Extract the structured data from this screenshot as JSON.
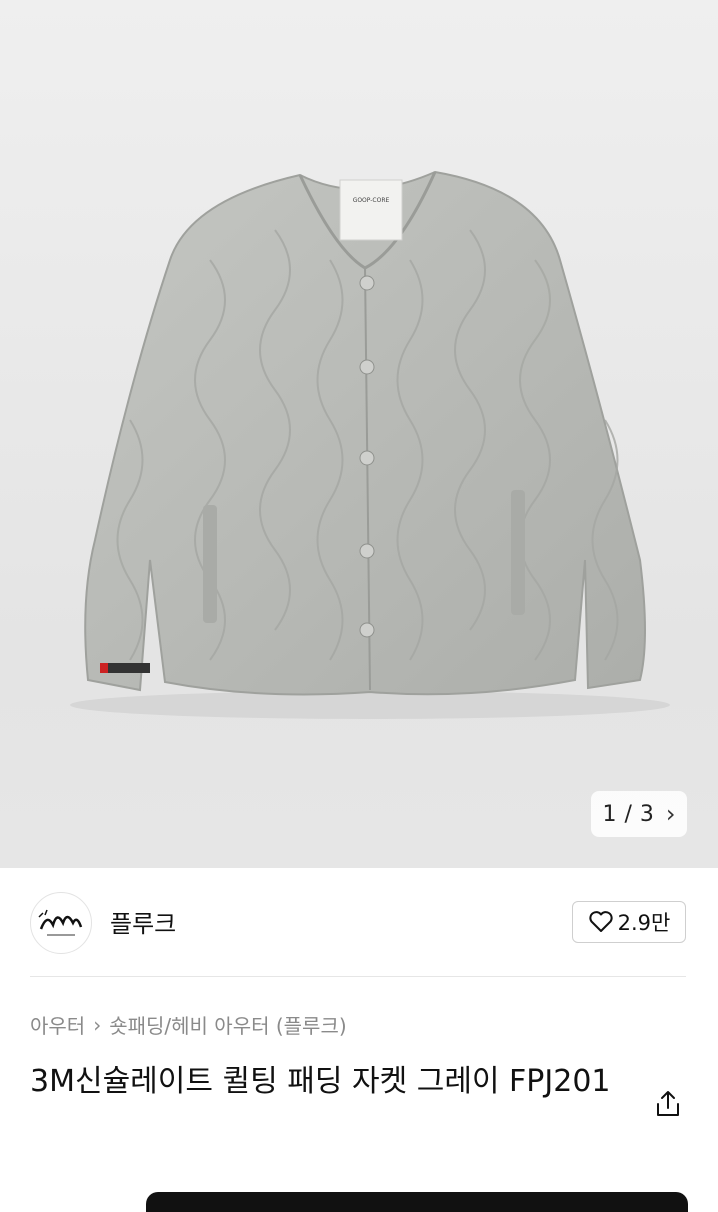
{
  "gallery": {
    "current": "1",
    "separator": "/",
    "total": "3",
    "next_icon": "chevron-right-icon",
    "label_text": "GOOP-CORE"
  },
  "seller": {
    "name": "플루크",
    "avatar": "brand-logo",
    "like_count": "2.9만",
    "like_icon": "heart-outline-icon"
  },
  "breadcrumb": {
    "category": "아우터",
    "separator_icon": "chevron-right-icon",
    "subcategory": "숏패딩/헤비 아우터 (플루크)"
  },
  "product": {
    "title": "3M신슐레이트 퀼팅 패딩 자켓 그레이 FPJ201",
    "share_icon": "share-icon"
  },
  "colors": {
    "jacket": "#b9bbb7",
    "background": "#e9e9e9",
    "bottom_bar": "#111111"
  }
}
